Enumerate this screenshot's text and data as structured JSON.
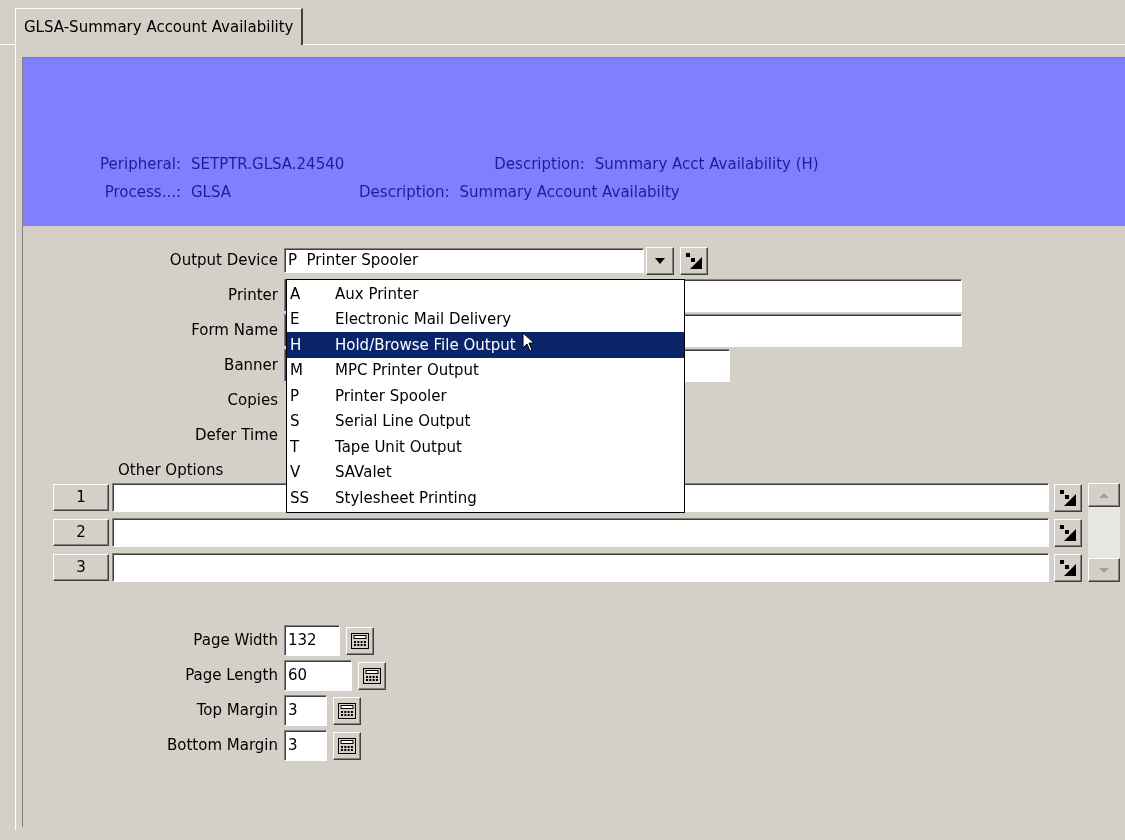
{
  "tab": {
    "label": "GLSA-Summary Account Availability",
    "selected": true
  },
  "header": {
    "rows": [
      {
        "label": "Peripheral:",
        "value": "SETPTR.GLSA.24540",
        "description_label": "Description:",
        "description": "Summary Acct Availability (H)"
      },
      {
        "label": "Process...:",
        "value": "GLSA",
        "description_label": "Description:",
        "description": "Summary Account Availabilty"
      }
    ]
  },
  "output_device": {
    "label": "Output Device",
    "value": "P  Printer Spooler",
    "expanded": true,
    "options": [
      {
        "code": "A",
        "label": "Aux Printer",
        "selected": false
      },
      {
        "code": "E",
        "label": "Electronic Mail Delivery",
        "selected": false
      },
      {
        "code": "H",
        "label": "Hold/Browse File Output",
        "selected": true
      },
      {
        "code": "M",
        "label": "MPC Printer Output",
        "selected": false
      },
      {
        "code": "P",
        "label": "Printer Spooler",
        "selected": false
      },
      {
        "code": "S",
        "label": "Serial Line Output",
        "selected": false
      },
      {
        "code": "T",
        "label": "Tape Unit Output",
        "selected": false
      },
      {
        "code": "V",
        "label": "SAValet",
        "selected": false
      },
      {
        "code": "SS",
        "label": "Stylesheet Printing",
        "selected": false
      }
    ]
  },
  "fields": [
    {
      "label": "Printer",
      "kind": "wide"
    },
    {
      "label": "Form Name",
      "kind": "wide"
    },
    {
      "label": "Banner",
      "kind": "medium"
    },
    {
      "label": "Copies",
      "kind": "hidden"
    },
    {
      "label": "Defer Time",
      "kind": "hidden"
    }
  ],
  "other_options": {
    "label": "Other Options",
    "rows": [
      {
        "number": "1"
      },
      {
        "number": "2"
      },
      {
        "number": "3"
      }
    ]
  },
  "page_settings": [
    {
      "label": "Page Width",
      "value": "132"
    },
    {
      "label": "Page Length",
      "value": "60"
    },
    {
      "label": "Top Margin",
      "value": "3"
    },
    {
      "label": "Bottom Margin",
      "value": "3"
    }
  ]
}
